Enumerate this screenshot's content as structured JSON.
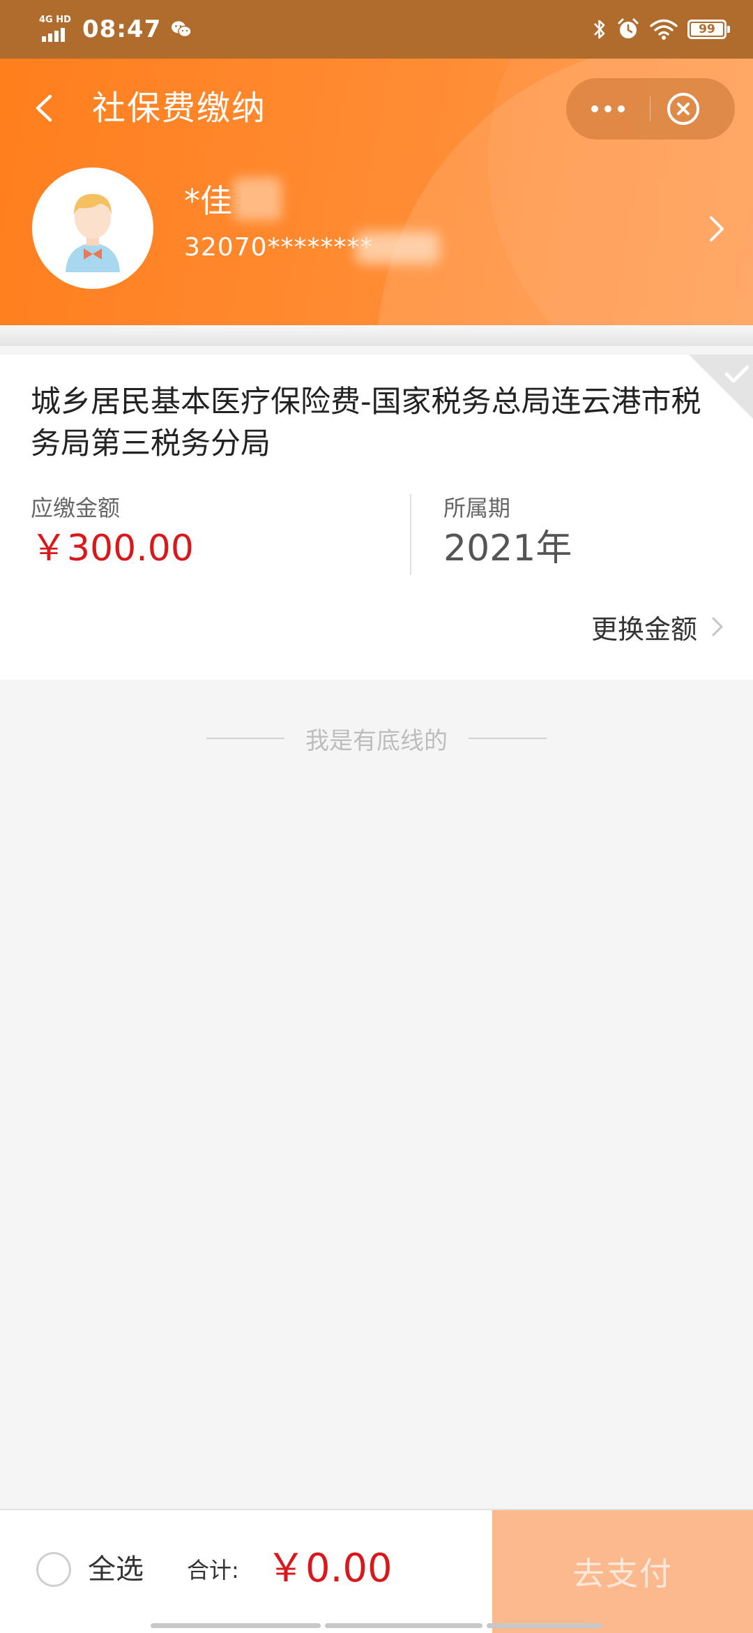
{
  "status_bar": {
    "network": "4G HD",
    "time": "08:47",
    "battery": "99",
    "icons": [
      "signal-icon",
      "wechat-icon",
      "bluetooth-icon",
      "alarm-icon",
      "wifi-icon",
      "battery-icon"
    ]
  },
  "nav": {
    "title": "社保费缴纳",
    "back_icon": "chevron-left-icon",
    "more_icon": "more-dots-icon",
    "close_icon": "close-circle-icon"
  },
  "profile": {
    "name": "*佳",
    "id_number": "32070********",
    "avatar_icon": "user-avatar-icon",
    "arrow_icon": "chevron-right-icon"
  },
  "item": {
    "title": "城乡居民基本医疗保险费-国家税务总局连云港市税务局第三税务分局",
    "amount_label": "应缴金额",
    "amount_value": "￥300.00",
    "period_label": "所属期",
    "period_value": "2021年",
    "change_amount_label": "更换金额",
    "selected": true
  },
  "end_text": "我是有底线的",
  "bottom": {
    "select_all_label": "全选",
    "total_label": "合计:",
    "total_value": "￥0.00",
    "pay_label": "去支付"
  },
  "colors": {
    "header_orange": "#ff8c34",
    "status_bar_brown": "#b06c2c",
    "price_red": "#d9181b",
    "pay_button_disabled": "#fdb98e",
    "background": "#f5f5f5"
  }
}
